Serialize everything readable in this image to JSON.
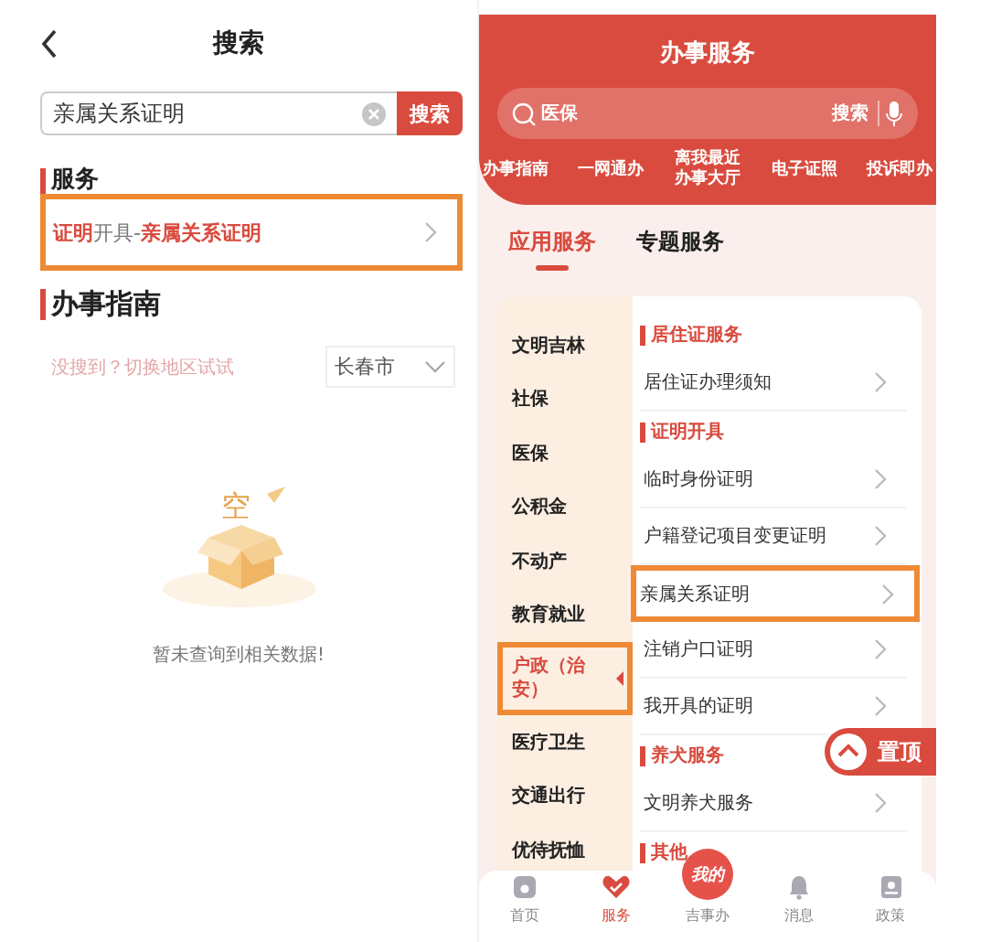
{
  "search_screen": {
    "title": "搜索",
    "search": {
      "value": "亲属关系证明",
      "button": "搜索"
    },
    "service_heading": "服务",
    "results": [
      {
        "segments": [
          {
            "text": "证明",
            "highlight": true
          },
          {
            "text": "开具-",
            "highlight": false
          },
          {
            "text": "亲属关系证明",
            "highlight": true
          }
        ],
        "annotated": true
      }
    ],
    "guide_heading": "办事指南",
    "region_hint": "没搜到？切换地区试试",
    "region": "长春市",
    "empty_mark": "空",
    "empty_message": "暂未查询到相关数据!"
  },
  "service_screen": {
    "title": "办事服务",
    "search": {
      "placeholder": "医保",
      "button": "搜索"
    },
    "quick_links": [
      {
        "label": "办事指南"
      },
      {
        "label": "一网通办"
      },
      {
        "label": "离我最近办事大厅"
      },
      {
        "label": "电子证照"
      },
      {
        "label": "投诉即办"
      }
    ],
    "tabs": [
      {
        "label": "应用服务",
        "selected": true
      },
      {
        "label": "专题服务",
        "selected": false
      }
    ],
    "categories": [
      {
        "label": "文明吉林",
        "selected": false,
        "annotated": false
      },
      {
        "label": "社保",
        "selected": false,
        "annotated": false
      },
      {
        "label": "医保",
        "selected": false,
        "annotated": false
      },
      {
        "label": "公积金",
        "selected": false,
        "annotated": false
      },
      {
        "label": "不动产",
        "selected": false,
        "annotated": false
      },
      {
        "label": "教育就业",
        "selected": false,
        "annotated": false
      },
      {
        "label": "户政（治安）",
        "selected": true,
        "annotated": true
      },
      {
        "label": "医疗卫生",
        "selected": false,
        "annotated": false
      },
      {
        "label": "交通出行",
        "selected": false,
        "annotated": false
      },
      {
        "label": "优待抚恤",
        "selected": false,
        "annotated": false
      }
    ],
    "sections": [
      {
        "heading": "居住证服务",
        "items": [
          {
            "label": "居住证办理须知",
            "annotated": false
          }
        ]
      },
      {
        "heading": "证明开具",
        "items": [
          {
            "label": "临时身份证明",
            "annotated": false
          },
          {
            "label": "户籍登记项目变更证明",
            "annotated": false
          },
          {
            "label": "亲属关系证明",
            "annotated": true
          },
          {
            "label": "注销户口证明",
            "annotated": false
          },
          {
            "label": "我开具的证明",
            "annotated": false
          }
        ]
      },
      {
        "heading": "养犬服务",
        "items": [
          {
            "label": "文明养犬服务",
            "annotated": false
          }
        ]
      },
      {
        "heading": "其他"
      }
    ],
    "top_button": "置顶",
    "nav": [
      {
        "kind": "home",
        "label": "首页",
        "selected": false
      },
      {
        "kind": "service",
        "label": "服务",
        "selected": true
      },
      {
        "kind": "center",
        "label": "吉事办",
        "badge": "我的",
        "selected": false
      },
      {
        "kind": "bell",
        "label": "消息",
        "selected": false
      },
      {
        "kind": "policy",
        "label": "政策",
        "selected": false
      }
    ]
  }
}
